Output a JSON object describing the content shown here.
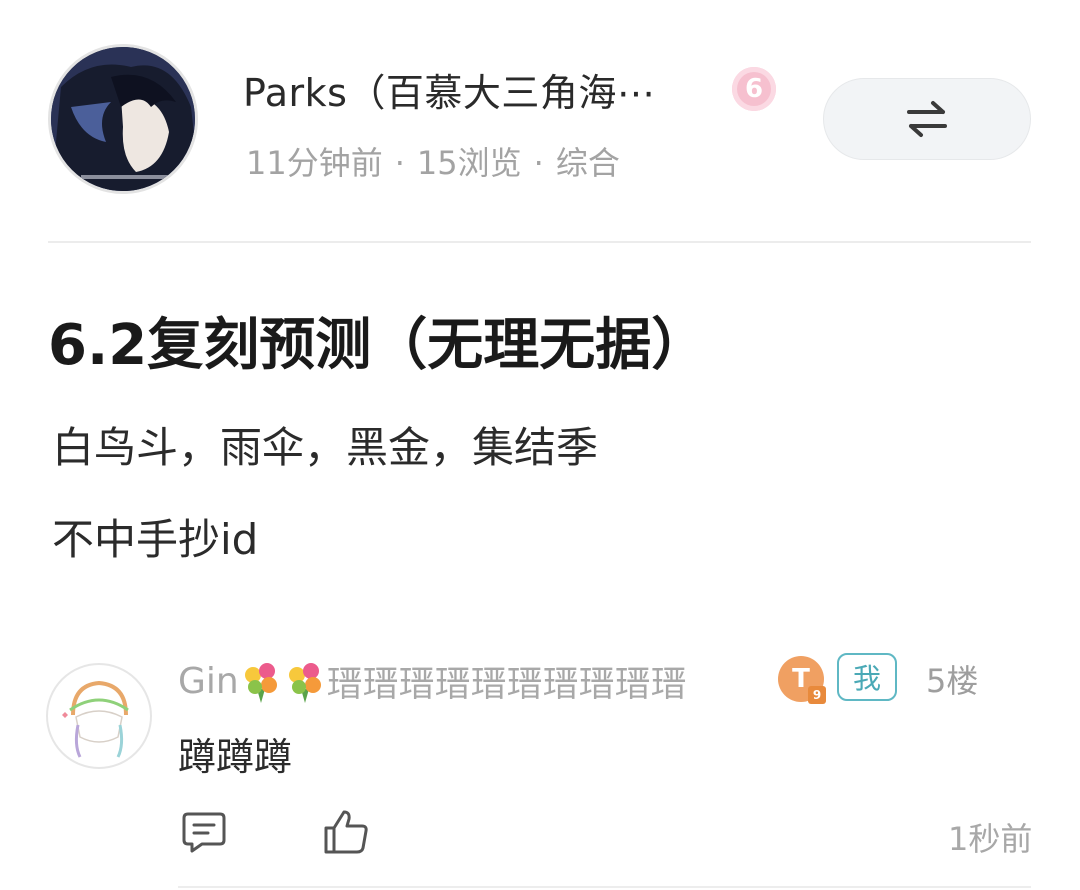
{
  "post": {
    "author": "Parks（百慕大三角海⋯",
    "level_badge": "6",
    "meta": {
      "time": "11分钟前",
      "views": "15浏览",
      "category": "综合",
      "separator": "·"
    },
    "title": "6.2复刻预测（无理无据）",
    "lines": [
      "白鸟斗，雨伞，黑金，集结季",
      "不中手抄id"
    ]
  },
  "comment": {
    "username_prefix": "Gin",
    "username_suffix": "瑨瑨瑨瑨瑨瑨瑨瑨瑨瑨",
    "badge_letter": "T",
    "badge_level": "9",
    "me_tag": "我",
    "floor": "5楼",
    "text": "蹲蹲蹲",
    "time": "1秒前"
  },
  "icons": {
    "swap": "swap-arrows-icon",
    "reply": "comment-bubble-icon",
    "like": "thumbs-up-icon",
    "flower": "bouquet-icon"
  },
  "colors": {
    "level_badge": "#f6c0cf",
    "me_tag": "#4aa9b6",
    "t_badge": "#f0a062",
    "muted_text": "#a3a3a3"
  }
}
